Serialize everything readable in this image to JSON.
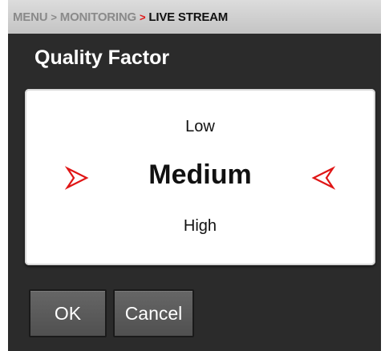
{
  "breadcrumb": {
    "items": [
      "MENU",
      "MONITORING",
      "LIVE STREAM"
    ],
    "separator": ">"
  },
  "title": "Quality Factor",
  "picker": {
    "previous": "Low",
    "current": "Medium",
    "next": "High",
    "left_icon": "chevron-right-icon",
    "right_icon": "chevron-left-icon"
  },
  "buttons": {
    "ok": "OK",
    "cancel": "Cancel"
  },
  "colors": {
    "accent": "#e01515",
    "background": "#2b2b2b",
    "breadcrumb_bar": "#c4c4c4",
    "button": "#5a5a5a"
  }
}
